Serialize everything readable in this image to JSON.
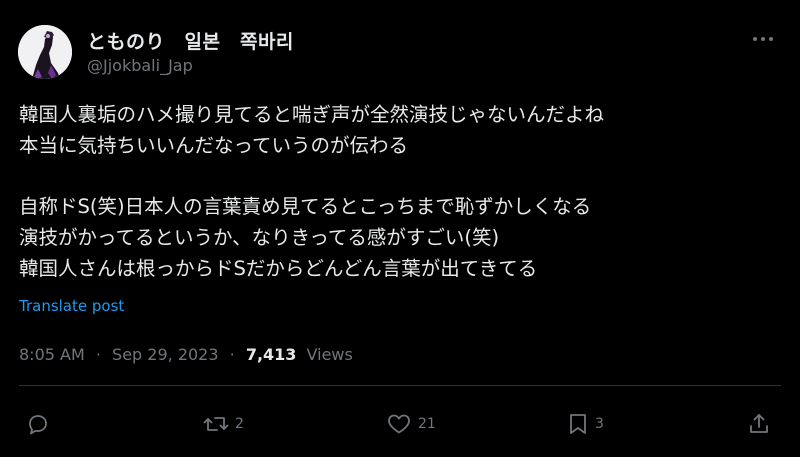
{
  "author": {
    "display_name": "とものり　일본　쪽바리",
    "handle": "@Jjokbali_Jap"
  },
  "tweet": {
    "lines": [
      "韓国人裏垢のハメ撮り見てると喘ぎ声が全然演技じゃないんだよね",
      "本当に気持ちいいんだなっていうのが伝わる",
      "",
      "自称ドS(笑)日本人の言葉責め見てるとこっちまで恥ずかしくなる",
      "演技がかってるというか、なりきってる感がすごい(笑)",
      "韓国人さんは根っからドSだからどんどん言葉が出てきてる"
    ],
    "translate_label": "Translate post"
  },
  "meta": {
    "time": "8:05 AM",
    "separator": "·",
    "date": "Sep 29, 2023",
    "views_count": "7,413",
    "views_label": "Views"
  },
  "actions": {
    "reply_count": "",
    "repost_count": "2",
    "like_count": "21",
    "bookmark_count": "3"
  },
  "colors": {
    "background": "#000000",
    "text": "#e7e9ea",
    "secondary": "#71767b",
    "link": "#1d9bf0",
    "divider": "#2f3336"
  },
  "icons": {
    "more": "more-horizontal-icon",
    "reply": "reply-icon",
    "repost": "repost-icon",
    "like": "heart-icon",
    "bookmark": "bookmark-icon",
    "share": "share-icon"
  }
}
